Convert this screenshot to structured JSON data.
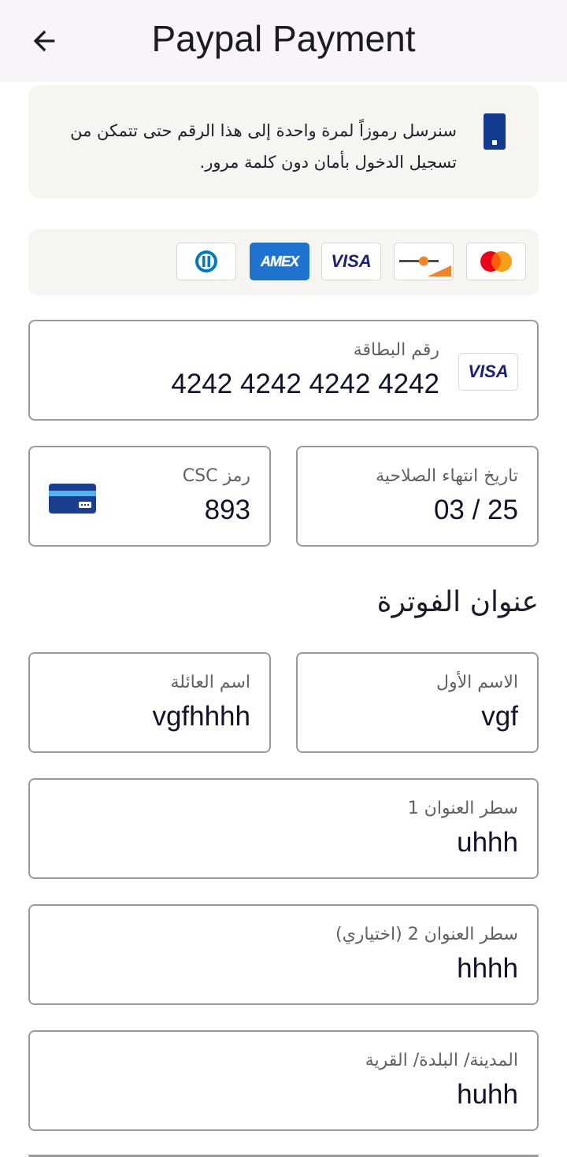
{
  "header": {
    "title": "Paypal Payment",
    "back_icon": "arrow-left-icon"
  },
  "notice": {
    "text": "سنرسل رموزاً لمرة واحدة إلى هذا الرقم حتى تتمكن من تسجيل الدخول بأمان دون كلمة مرور.",
    "icon": "phone-icon",
    "icon_color": "#123a8e"
  },
  "card_brands": {
    "items": [
      "diners-club",
      "amex",
      "visa",
      "discover",
      "mastercard"
    ],
    "amex_label": "AMEX",
    "visa_label": "VISA"
  },
  "card_number": {
    "label": "رقم البطاقة",
    "value": "4242 4242 4242 4242",
    "brand_label": "VISA"
  },
  "expiry": {
    "label": "تاريخ انتهاء الصلاحية",
    "value": "03 / 25"
  },
  "csc": {
    "label": "رمز CSC",
    "value": "893",
    "icon": "card-back-icon"
  },
  "billing": {
    "title": "عنوان الفوترة",
    "first_name": {
      "label": "الاسم الأول",
      "value": "vgf"
    },
    "last_name": {
      "label": "اسم العائلة",
      "value": "vgfhhhh"
    },
    "address1": {
      "label": "سطر العنوان 1",
      "value": "uhhh"
    },
    "address2": {
      "label": "سطر العنوان 2 (اختياري)",
      "value": "hhhh"
    },
    "city": {
      "label": "المدينة/ البلدة/ القرية",
      "value": "huhh"
    }
  },
  "colors": {
    "header_bg": "#f9f4fa",
    "panel_bg": "#f6f5f2",
    "border": "#9a9a9a",
    "visa_blue": "#1a1f71",
    "amex_blue": "#1f72cd"
  }
}
